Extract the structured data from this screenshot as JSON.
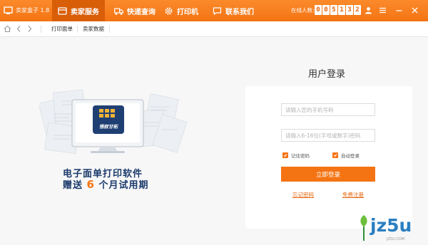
{
  "app": {
    "name": "卖家盒子 1.8"
  },
  "tabs": [
    {
      "label": "卖家服务",
      "icon": "store-icon",
      "active": true
    },
    {
      "label": "快递查询",
      "icon": "truck-icon",
      "active": false
    },
    {
      "label": "打印机",
      "icon": "gear-icon",
      "active": false
    },
    {
      "label": "联系我们",
      "icon": "message-icon",
      "active": false
    }
  ],
  "online": {
    "label": "在线人数:",
    "digits": [
      "0",
      "0",
      "5",
      "1",
      "3",
      "2"
    ]
  },
  "nav": {
    "links": [
      "打印面单",
      "卖家数据"
    ]
  },
  "promo": {
    "box_text": "悟叙甘柘",
    "line1": "电子面单打印软件",
    "line2_prefix": "赠送",
    "line2_number": "6",
    "line2_suffix": "个月试用期"
  },
  "login": {
    "title": "用户登录",
    "phone_placeholder": "请输入您的手机号码",
    "password_placeholder": "请输入6-16位(字母或数字)密码",
    "remember_label": "记住密码",
    "auto_label": "自动登录",
    "button_label": "立即登录",
    "forgot_label": "忘记密码",
    "register_label": "免费注册"
  },
  "watermark": {
    "text": "jz5u",
    "subtext": "JZ5U.COM"
  },
  "colors": {
    "accent": "#f47413",
    "active_tab": "#d95e08",
    "brand_blue": "#1b3a6b"
  }
}
